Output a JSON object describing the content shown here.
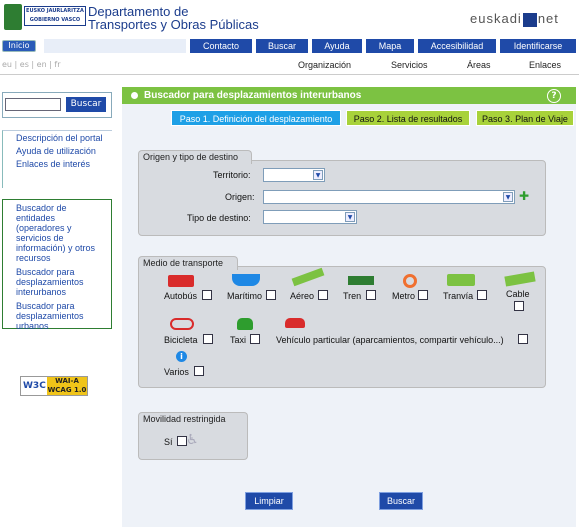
{
  "header": {
    "logo_text": "EUSKO JAURLARITZA GOBIERNO VASCO",
    "dept_line1": "Departamento de",
    "dept_line2": "Transportes y Obras Públicas",
    "brand": "euskadi",
    "brand_suffix": "net"
  },
  "nav": {
    "home": "Inicio",
    "items": [
      "Contacto",
      "Buscar",
      "Ayuda",
      "Mapa",
      "Accesibilidad",
      "Identificarse"
    ]
  },
  "langs": "eu | es | en | fr",
  "subnav": [
    "Organización",
    "Servicios",
    "Áreas",
    "Enlaces"
  ],
  "sidebar": {
    "search_btn": "Buscar",
    "links1": [
      "Descripción del portal",
      "Ayuda de utilización",
      "Enlaces de interés"
    ],
    "links2": [
      "Buscador de entidades (operadores y servicios de información) y otros recursos",
      "Buscador para desplazamientos interurbanos",
      "Buscador para desplazamientos urbanos"
    ],
    "w3c": "W3C",
    "wai": "WAI-A",
    "wcag": "WCAG 1.0"
  },
  "main": {
    "title": "Buscador para desplazamientos interurbanos",
    "steps": [
      "Paso 1. Definición del desplazamiento",
      "Paso 2. Lista de resultados",
      "Paso 3. Plan de Viaje"
    ],
    "origin_legend": "Origen y tipo de destino",
    "territorio": "Territorio:",
    "origen": "Origen:",
    "tipo": "Tipo de destino:",
    "transport_legend": "Medio de transporte",
    "modes_row1": [
      "Autobús",
      "Marítimo",
      "Aéreo",
      "Tren",
      "Metro",
      "Tranvía",
      "Cable"
    ],
    "modes_row2": [
      "Bicicleta",
      "Taxi",
      "Vehículo particular (aparcamientos, compartir vehículo...)"
    ],
    "varios": "Varios",
    "mobility_legend": "Movilidad restringida",
    "si": "Sí",
    "limpiar": "Limpiar",
    "buscar": "Buscar"
  },
  "colors": {
    "accent": "#1f4aa8",
    "green": "#7cc242",
    "step_active": "#1ea0e6",
    "step_inactive": "#a8d23a"
  }
}
